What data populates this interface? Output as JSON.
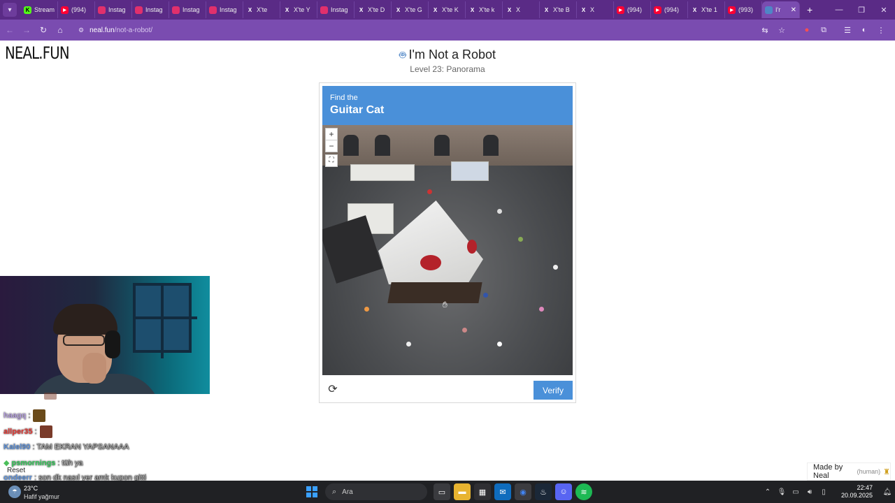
{
  "browser": {
    "tabs": [
      {
        "label": "Stream",
        "icon": "kick-icon",
        "color": "#53fc18"
      },
      {
        "label": "(994)",
        "icon": "youtube-icon",
        "color": "#ff0033"
      },
      {
        "label": "Instag",
        "icon": "instagram-icon",
        "color": "#e1306c"
      },
      {
        "label": "Instag",
        "icon": "instagram-icon",
        "color": "#e1306c"
      },
      {
        "label": "Instag",
        "icon": "instagram-icon",
        "color": "#e1306c"
      },
      {
        "label": "Instag",
        "icon": "instagram-icon",
        "color": "#e1306c"
      },
      {
        "label": "X'te",
        "icon": "x-icon",
        "color": "#000000"
      },
      {
        "label": "X'te Y",
        "icon": "x-icon",
        "color": "#000000"
      },
      {
        "label": "Instag",
        "icon": "instagram-icon",
        "color": "#e1306c"
      },
      {
        "label": "X'te D",
        "icon": "x-icon",
        "color": "#000000"
      },
      {
        "label": "X'te G",
        "icon": "x-icon",
        "color": "#000000"
      },
      {
        "label": "X'te K",
        "icon": "x-icon",
        "color": "#000000"
      },
      {
        "label": "X'te k",
        "icon": "x-icon",
        "color": "#000000"
      },
      {
        "label": "X",
        "icon": "x-icon",
        "color": "#000000"
      },
      {
        "label": "X'te B",
        "icon": "x-icon",
        "color": "#000000"
      },
      {
        "label": "X",
        "icon": "x-icon",
        "color": "#000000"
      },
      {
        "label": "(994)",
        "icon": "youtube-icon",
        "color": "#ff0033"
      },
      {
        "label": "(994)",
        "icon": "youtube-icon",
        "color": "#ff0033"
      },
      {
        "label": "X'te 1",
        "icon": "x-icon",
        "color": "#000000"
      },
      {
        "label": "(993)",
        "icon": "youtube-icon",
        "color": "#ff0033"
      },
      {
        "label": "I'r",
        "icon": "robot-icon",
        "color": "#4f86c6",
        "active": true
      }
    ],
    "url_host": "neal.fun",
    "url_path": "/not-a-robot/"
  },
  "page": {
    "logo": "NEAL.FUN",
    "title": "I'm Not a Robot",
    "subtitle": "Level 23: Panorama"
  },
  "captcha": {
    "find_label": "Find the",
    "target": "Guitar Cat",
    "zoom_in": "+",
    "zoom_out": "−",
    "verify_label": "Verify",
    "accent": "#4a90d9"
  },
  "stream": {
    "chat": [
      {
        "user": "haagq",
        "user_color": "#b39ddb",
        "text": ":",
        "emote": true
      },
      {
        "user": "allper35",
        "user_color": "#e53935",
        "text": ":",
        "emote": true
      },
      {
        "user": "Kalel90",
        "user_color": "#5c8fd6",
        "text": ": TAM EKRAN YAPSANAAA",
        "emote": false
      },
      {
        "user": "psmornings",
        "user_color": "#34c759",
        "text": ": tüh ya",
        "emote": false,
        "badge": true
      },
      {
        "user": "ondeerr",
        "user_color": "#5c8fd6",
        "text": ": son dk nasıl yer amk kupon gitti",
        "emote": false
      }
    ],
    "reset_label": "Reset"
  },
  "footer": {
    "made_by": "Made by Neal",
    "human": "(human)"
  },
  "taskbar": {
    "temperature": "23°C",
    "condition": "Hafif yağmur",
    "search_placeholder": "Ara",
    "time": "22:47",
    "date": "20.09.2025"
  }
}
